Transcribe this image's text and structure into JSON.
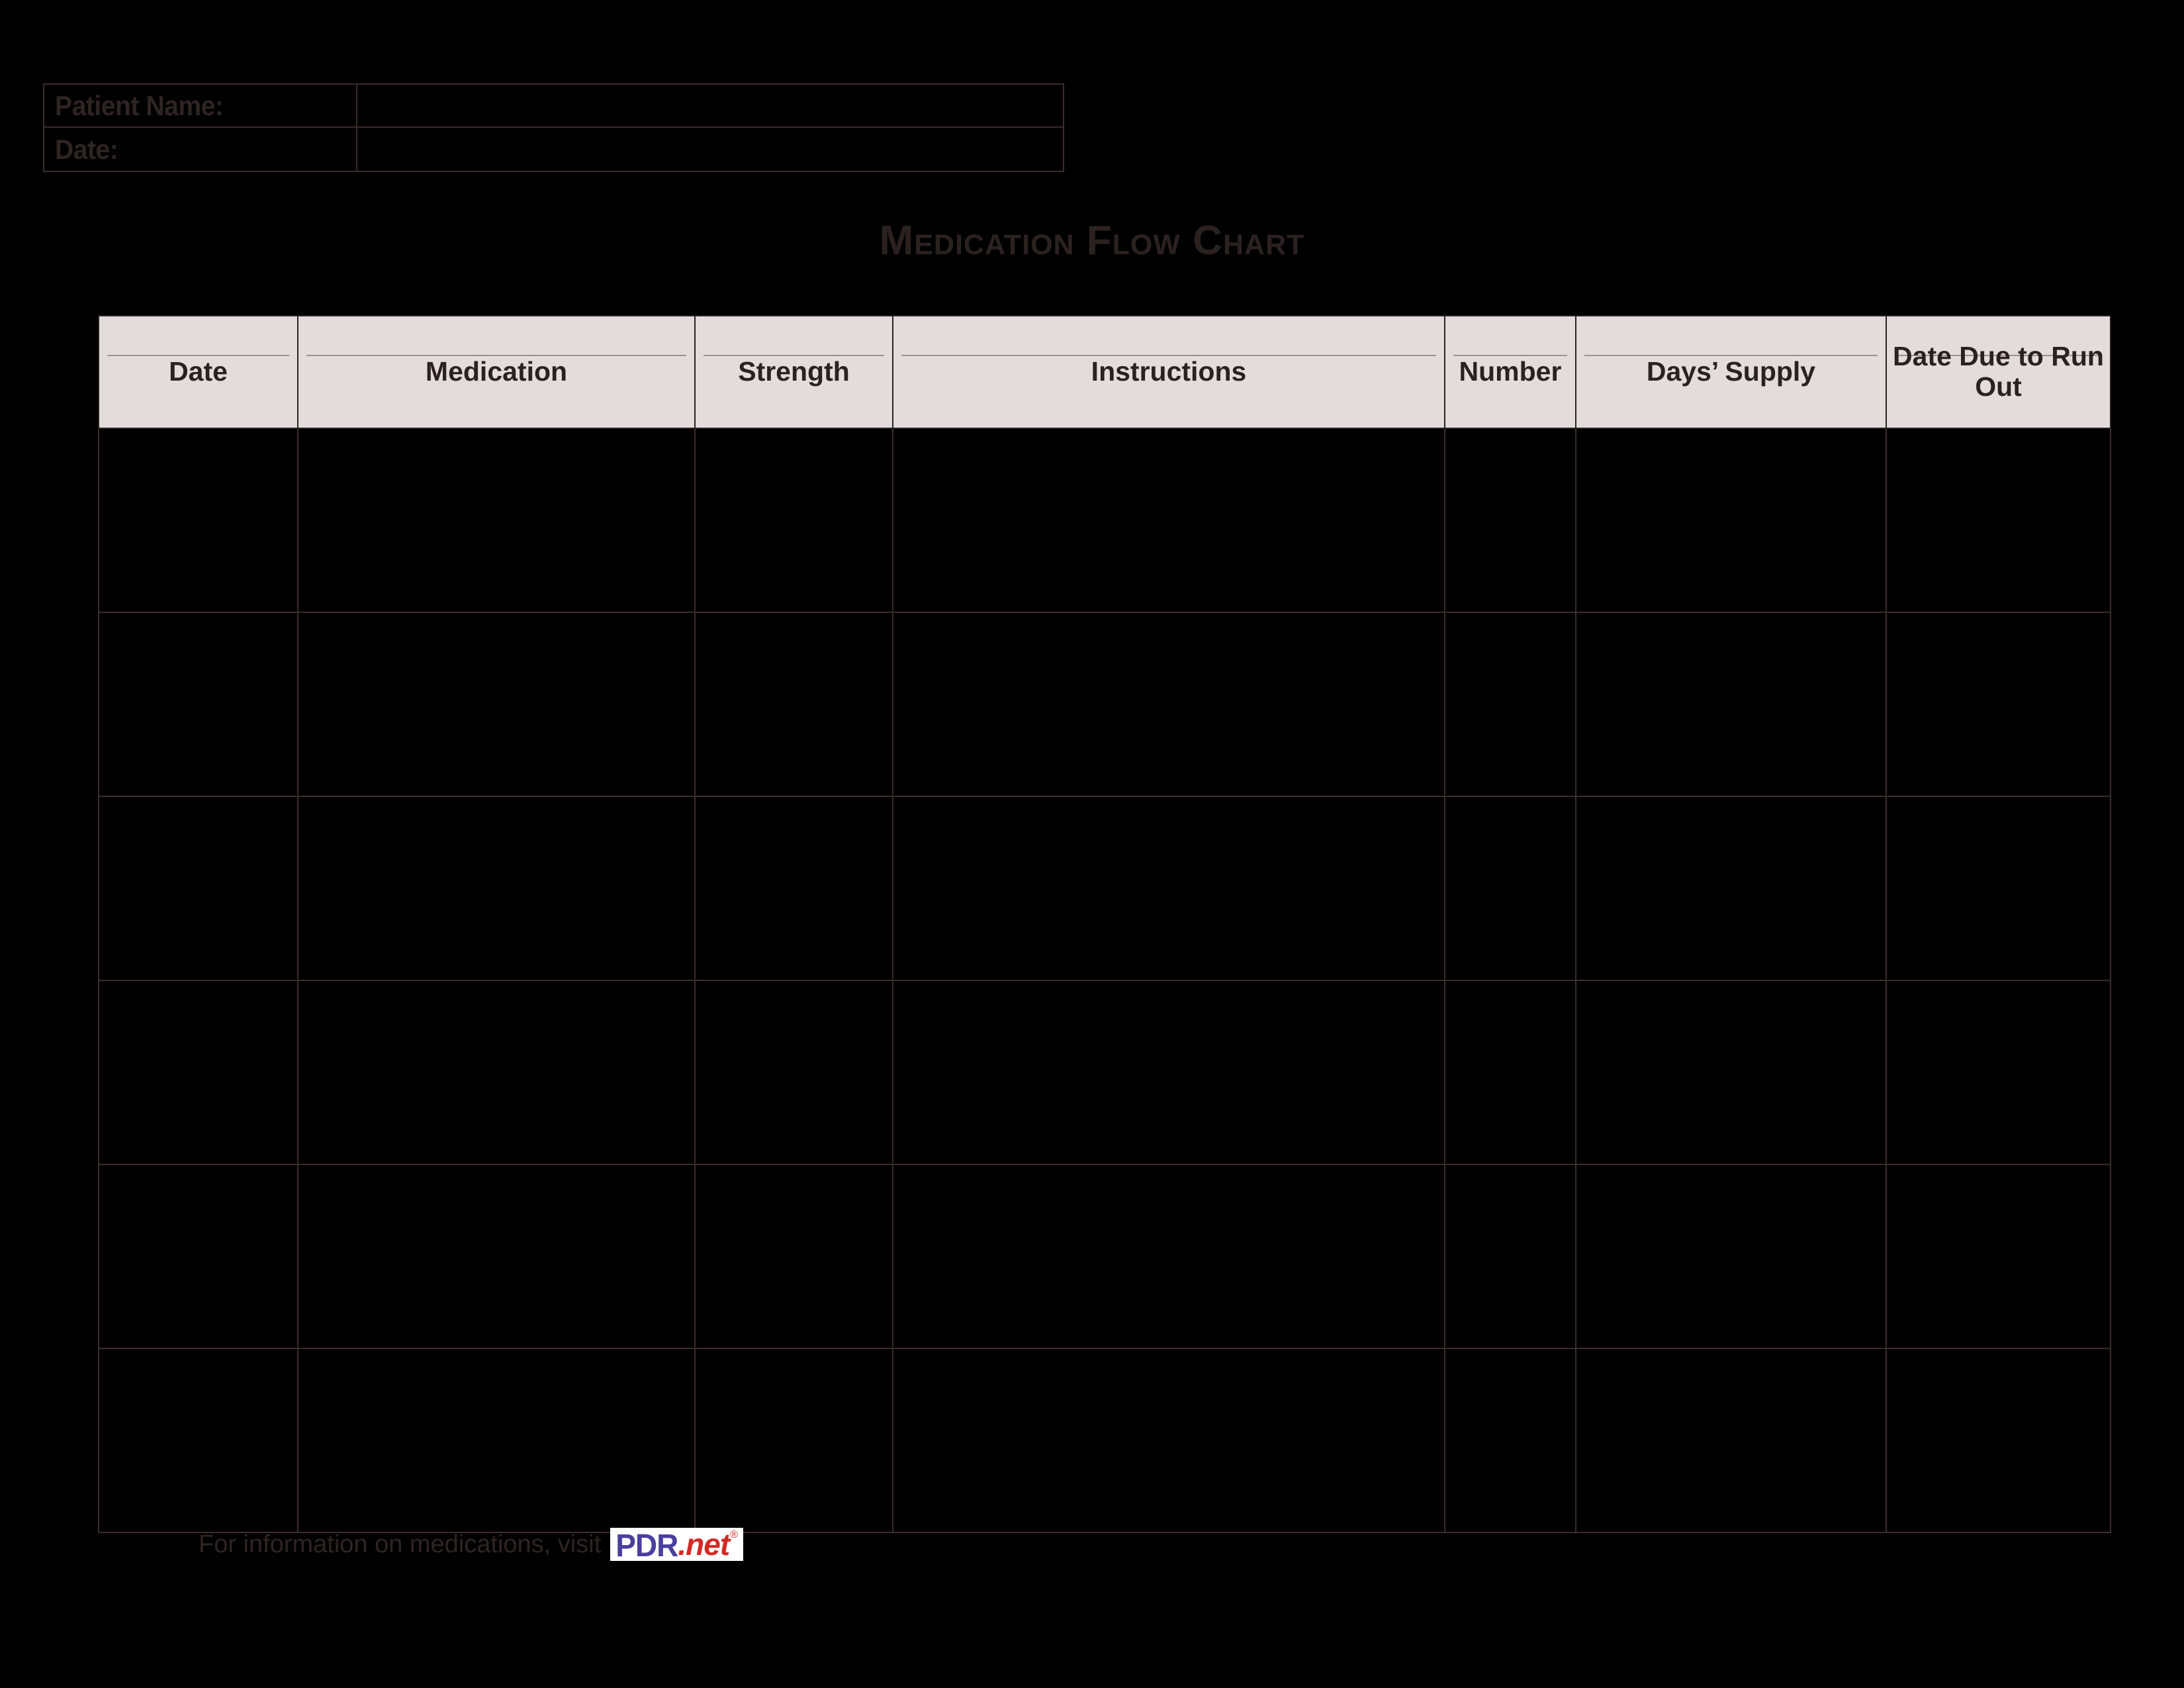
{
  "patient_info": {
    "rows": [
      {
        "label": "Patient Name:",
        "value": ""
      },
      {
        "label": "Date:",
        "value": ""
      }
    ]
  },
  "title": "Medication Flow Chart",
  "table": {
    "columns": [
      "Date",
      "Medication",
      "Strength",
      "Instructions",
      "Number",
      "Days’ Supply",
      "Date Due to Run Out"
    ],
    "rows": [
      [
        "",
        "",
        "",
        "",
        "",
        "",
        ""
      ],
      [
        "",
        "",
        "",
        "",
        "",
        "",
        ""
      ],
      [
        "",
        "",
        "",
        "",
        "",
        "",
        ""
      ],
      [
        "",
        "",
        "",
        "",
        "",
        "",
        ""
      ],
      [
        "",
        "",
        "",
        "",
        "",
        "",
        ""
      ],
      [
        "",
        "",
        "",
        "",
        "",
        "",
        ""
      ]
    ]
  },
  "footer": {
    "text": "For information on medications, visit",
    "logo": {
      "mark": "PDR",
      "suffix": ".net",
      "registered": "®"
    }
  },
  "colors": {
    "page_background": "#000000",
    "ink": "#2B2220",
    "header_fill": "#E2DDDC",
    "grid_line": "#3A2D2A",
    "header_rule": "#9A9290",
    "logo_purple": "#4A3F9E",
    "logo_red": "#D42A25"
  }
}
